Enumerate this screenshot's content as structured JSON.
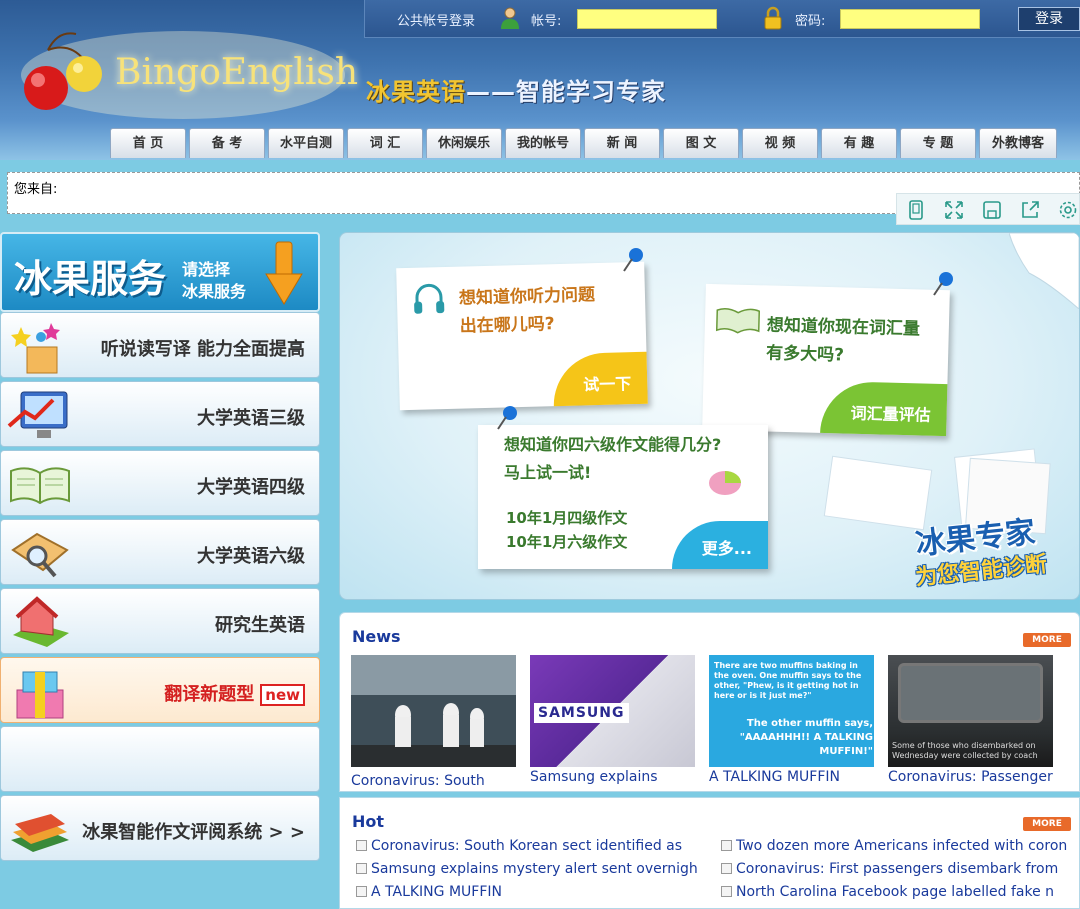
{
  "login": {
    "title": "公共帐号登录",
    "account_label": "帐号:",
    "account_value": "",
    "password_label": "密码:",
    "password_value": "",
    "submit": "登录"
  },
  "brand": {
    "logo_text": "BingoEnglish",
    "slogan_highlight": "冰果英语",
    "slogan_rest": "——智能学习专家"
  },
  "nav": [
    "首 页",
    "备 考",
    "水平自测",
    "词 汇",
    "休闲娱乐",
    "我的帐号",
    "新 闻",
    "图 文",
    "视 频",
    "有 趣",
    "专 题",
    "外教博客"
  ],
  "from_bar": {
    "label": "您来自:"
  },
  "toolbar_icons": [
    "tablet-icon",
    "fullscreen-icon",
    "save-icon",
    "share-icon",
    "settings-icon"
  ],
  "sidebar": {
    "banner_title": "冰果服务",
    "banner_sub1": "请选择",
    "banner_sub2": "冰果服务",
    "items": [
      {
        "label": "听说读写译 能力全面提高",
        "icon": "stars-gift-icon"
      },
      {
        "label": "大学英语三级",
        "icon": "monitor-chart-icon"
      },
      {
        "label": "大学英语四级",
        "icon": "open-book-icon"
      },
      {
        "label": "大学英语六级",
        "icon": "magnifier-book-icon"
      },
      {
        "label": "研究生英语",
        "icon": "house-icon"
      },
      {
        "label": "翻译新题型",
        "icon": "gift-box-icon",
        "badge": "new",
        "highlight": true
      },
      {
        "label": "",
        "icon": ""
      },
      {
        "label": "冰果智能作文评阅系统 > >",
        "icon": "books-icon"
      }
    ]
  },
  "feature": {
    "note1_text": [
      "想知道你听力问题",
      "出在哪儿吗?"
    ],
    "note1_btn": "试一下",
    "note2_text": [
      "想知道你现在词汇量",
      "有多大吗?"
    ],
    "note2_btn": "词汇量评估",
    "note3_text": [
      "想知道你四六级作文能得几分?",
      "马上试一试!"
    ],
    "note3_links": [
      "10年1月四级作文",
      "10年1月六级作文"
    ],
    "note3_btn": "更多...",
    "stamp": "冰果专家",
    "stamp_sub": "为您智能诊断"
  },
  "news": {
    "title": "News",
    "more": "MORE",
    "items": [
      {
        "caption": "Coronavirus: South"
      },
      {
        "caption": "Samsung explains",
        "img_text": "SAMSUNG"
      },
      {
        "caption": "A TALKING MUFFIN",
        "img_text": "There are two muffins baking in the oven. One muffin says to the other, \"Phew, is it getting hot in here or is it just me?\"",
        "img_text2": "The other muffin says, \"AAAAHHH!! A TALKING MUFFIN!\""
      },
      {
        "caption": "Coronavirus: Passengers",
        "img_text": "Some of those who disembarked on Wednesday were collected by coach"
      }
    ]
  },
  "hot": {
    "title": "Hot",
    "more": "MORE",
    "items": [
      "Coronavirus: South Korean sect identified as",
      "Samsung explains mystery alert sent overnigh",
      "A TALKING MUFFIN",
      "Two dozen more Americans infected with coron",
      "Coronavirus: First passengers disembark from",
      "North Carolina Facebook page labelled fake n"
    ]
  },
  "colors": {
    "header_dark": "#2d5b95",
    "page_bg": "#7dcbe3",
    "login_field": "#ffff80",
    "link_blue": "#1a3a9c",
    "more_orange": "#e86a2a",
    "btn_yellow": "#f5c518",
    "btn_green": "#7bc434",
    "btn_blue": "#2bb0e0"
  }
}
